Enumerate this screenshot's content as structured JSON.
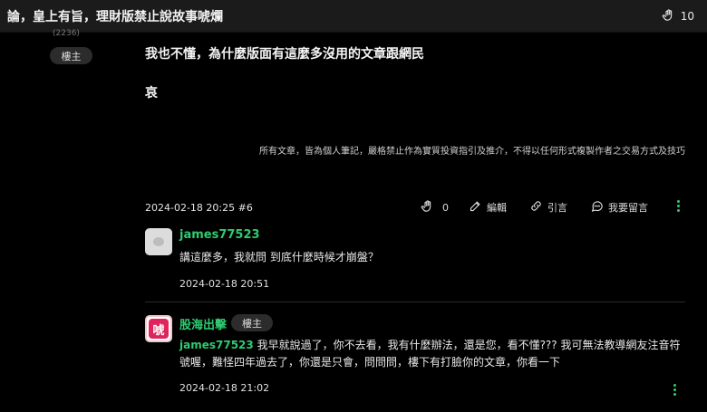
{
  "topbar": {
    "title": "論，皇上有旨，理財版禁止說故事唬爛",
    "clap_count": "10"
  },
  "author_side": {
    "cut_text": "(2236)",
    "badge": "樓主"
  },
  "post": {
    "line1": "我也不懂，為什麼版面有這麼多沒用的文章跟網民",
    "line2": "哀",
    "disclaimer": "所有文章，皆為個人筆記，嚴格禁止作為實質投資指引及推介，不得以任何形式複製作者之交易方式及技巧",
    "meta": {
      "date": "2024-02-18 20:25 #6",
      "clap_count": "0",
      "edit_label": "編輯",
      "quote_label": "引言",
      "reply_label": "我要留言"
    }
  },
  "comments": [
    {
      "name": "james77523",
      "text": "講這麼多，我就問 到底什麼時候才崩盤？",
      "date": "2024-02-18 20:51"
    },
    {
      "name": "股海出擊",
      "badge": "樓主",
      "avatar_glyph": "唬",
      "mention": "james77523",
      "text": " 我早就說過了，你不去看，我有什麼辦法，還是您，看不懂??? 我可無法教導網友注音符號喔，難怪四年過去了，你還是只會，問問問，樓下有打臉你的文章，你看一下",
      "date": "2024-02-18 21:02"
    }
  ],
  "colors": {
    "accent": "#2ecc71",
    "background": "#000000",
    "topbar": "#1b1b1b"
  },
  "icons": [
    "clap-icon",
    "pencil-icon",
    "quote-icon",
    "comment-icon",
    "more-icon"
  ]
}
